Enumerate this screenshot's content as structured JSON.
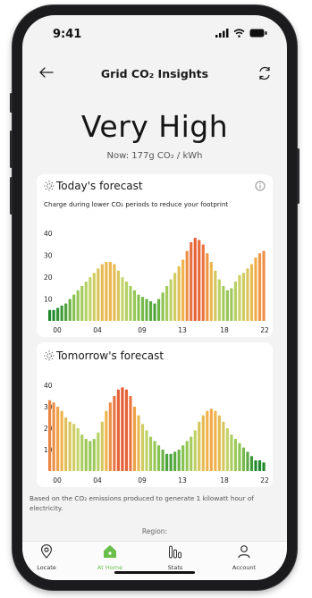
{
  "status_bar": {
    "time": "9:41"
  },
  "nav": {
    "title": "Grid CO₂ Insights"
  },
  "summary": {
    "level": "Very High",
    "now": "Now: 177g CO₂ / kWh"
  },
  "today": {
    "title": "Today's forecast",
    "subtitle": "Charge during lower CO₂ periods to reduce your footprint",
    "y_ticks": [
      "40",
      "30",
      "20",
      "10"
    ],
    "x_ticks": [
      "00",
      "04",
      "09",
      "13",
      "18",
      "22"
    ]
  },
  "tomorrow": {
    "title": "Tomorrow's forecast",
    "y_ticks": [
      "40",
      "30",
      "20",
      "10"
    ],
    "x_ticks": [
      "00",
      "04",
      "09",
      "13",
      "18",
      "22"
    ]
  },
  "chart_data": [
    {
      "type": "bar",
      "title": "Today's forecast",
      "x_tick_labels": [
        "00",
        "04",
        "09",
        "13",
        "18",
        "22"
      ],
      "ylim": [
        0,
        45
      ],
      "y_ticks": [
        10,
        20,
        30,
        40
      ],
      "values": [
        5,
        5,
        6,
        7,
        8,
        10,
        12,
        14,
        16,
        18,
        20,
        22,
        24,
        26,
        27,
        27,
        26,
        23,
        20,
        18,
        16,
        14,
        12,
        11,
        10,
        9,
        8,
        10,
        13,
        16,
        19,
        22,
        25,
        28,
        32,
        36,
        38,
        37,
        35,
        31,
        27,
        23,
        19,
        16,
        14,
        15,
        18,
        21,
        22,
        24,
        26,
        29,
        31,
        32
      ]
    },
    {
      "type": "bar",
      "title": "Tomorrow's forecast",
      "x_tick_labels": [
        "00",
        "04",
        "09",
        "13",
        "18",
        "22"
      ],
      "ylim": [
        0,
        45
      ],
      "y_ticks": [
        10,
        20,
        30,
        40
      ],
      "values": [
        33,
        32,
        30,
        28,
        25,
        23,
        22,
        20,
        17,
        15,
        14,
        15,
        18,
        23,
        28,
        32,
        35,
        38,
        39,
        38,
        35,
        30,
        26,
        22,
        19,
        16,
        14,
        12,
        10,
        8,
        8,
        9,
        10,
        12,
        14,
        16,
        19,
        23,
        26,
        28,
        29,
        28,
        26,
        23,
        20,
        17,
        15,
        13,
        11,
        9,
        7,
        5,
        5,
        4
      ]
    }
  ],
  "footer": {
    "note": "Based on the CO₂ emissions produced to generate 1 kilowatt hour of electricity.",
    "region_label": "Region:"
  },
  "tabs": [
    {
      "label": "Locate",
      "icon": "location-pin-icon"
    },
    {
      "label": "At Home",
      "icon": "home-icon"
    },
    {
      "label": "Stats",
      "icon": "bar-chart-icon"
    },
    {
      "label": "Account",
      "icon": "user-icon"
    }
  ],
  "colors": {
    "accent": "#6abf4b",
    "low": "#1f8a2c",
    "medium": "#d4d45a",
    "high": "#e4552f"
  }
}
